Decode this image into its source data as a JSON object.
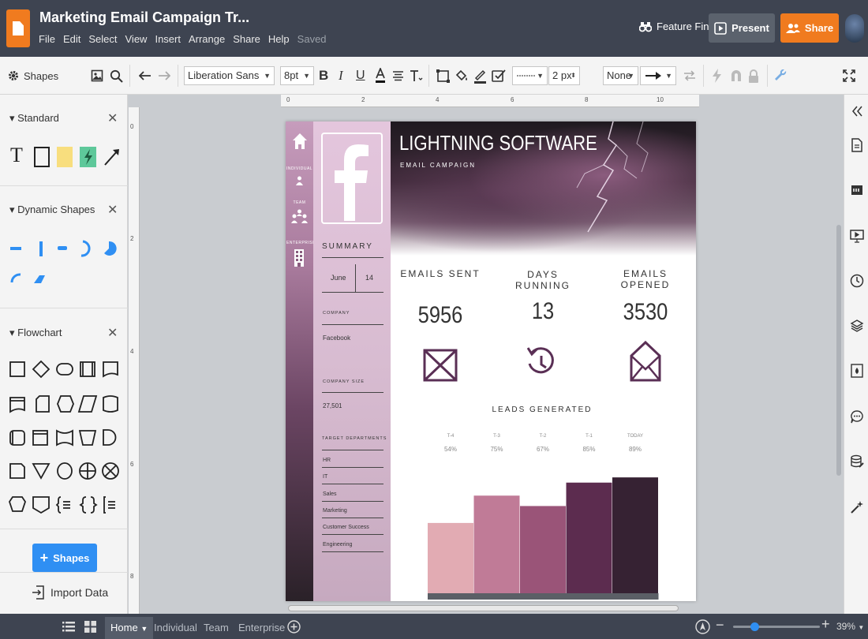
{
  "app": {
    "title": "Marketing Email Campaign Tr...",
    "menu": [
      "File",
      "Edit",
      "Select",
      "View",
      "Insert",
      "Arrange",
      "Share",
      "Help"
    ],
    "saved_status": "Saved",
    "feature_find": "Feature Find",
    "present": "Present",
    "share": "Share"
  },
  "toolbar": {
    "font_family": "Liberation Sans",
    "font_size": "8pt",
    "line_width": "2 px",
    "arrow_start": "None"
  },
  "left_panel": {
    "title": "Shapes",
    "sections": [
      {
        "title": "Standard"
      },
      {
        "title": "Dynamic Shapes"
      },
      {
        "title": "Flowchart"
      }
    ],
    "shapes_button": "Shapes",
    "import_data": "Import Data"
  },
  "rulers": {
    "top": [
      "0",
      "2",
      "4",
      "6",
      "8",
      "10"
    ],
    "left": [
      "0",
      "2",
      "4",
      "6",
      "8"
    ]
  },
  "document": {
    "nav_labels": [
      "INDIVIDUAL",
      "TEAM",
      "ENTERPRISE"
    ],
    "brand_title": "LIGHTNING SOFTWARE",
    "brand_subtitle": "EMAIL CAMPAIGN",
    "summary_title": "SUMMARY",
    "month": "June",
    "day": "14",
    "company_label": "COMPANY",
    "company_value": "Facebook",
    "company_size_label": "COMPANY SIZE",
    "company_size_value": "27,501",
    "target_label": "TARGET DEPARTMENTS",
    "departments": [
      "HR",
      "IT",
      "Sales",
      "Marketing",
      "Customer Success",
      "Engineering"
    ],
    "stats": [
      {
        "label": "EMAILS SENT",
        "value": "5956"
      },
      {
        "label": "DAYS RUNNING",
        "value": "13"
      },
      {
        "label": "EMAILS OPENED",
        "value": "3530"
      }
    ],
    "leads_title": "LEADS GENERATED"
  },
  "chart_data": {
    "type": "bar",
    "title": "LEADS GENERATED",
    "categories": [
      "T-4",
      "T-3",
      "T-2",
      "T-1",
      "TODAY"
    ],
    "labels": [
      "54%",
      "75%",
      "67%",
      "85%",
      "89%"
    ],
    "values": [
      54,
      75,
      67,
      85,
      89
    ],
    "colors": [
      "#e2abb3",
      "#c07b97",
      "#9a5478",
      "#5c2c4f",
      "#362233"
    ],
    "ylim": [
      0,
      100
    ]
  },
  "bottom": {
    "tabs": [
      "Home",
      "Individual",
      "Team",
      "Enterprise"
    ],
    "zoom": "39%"
  }
}
